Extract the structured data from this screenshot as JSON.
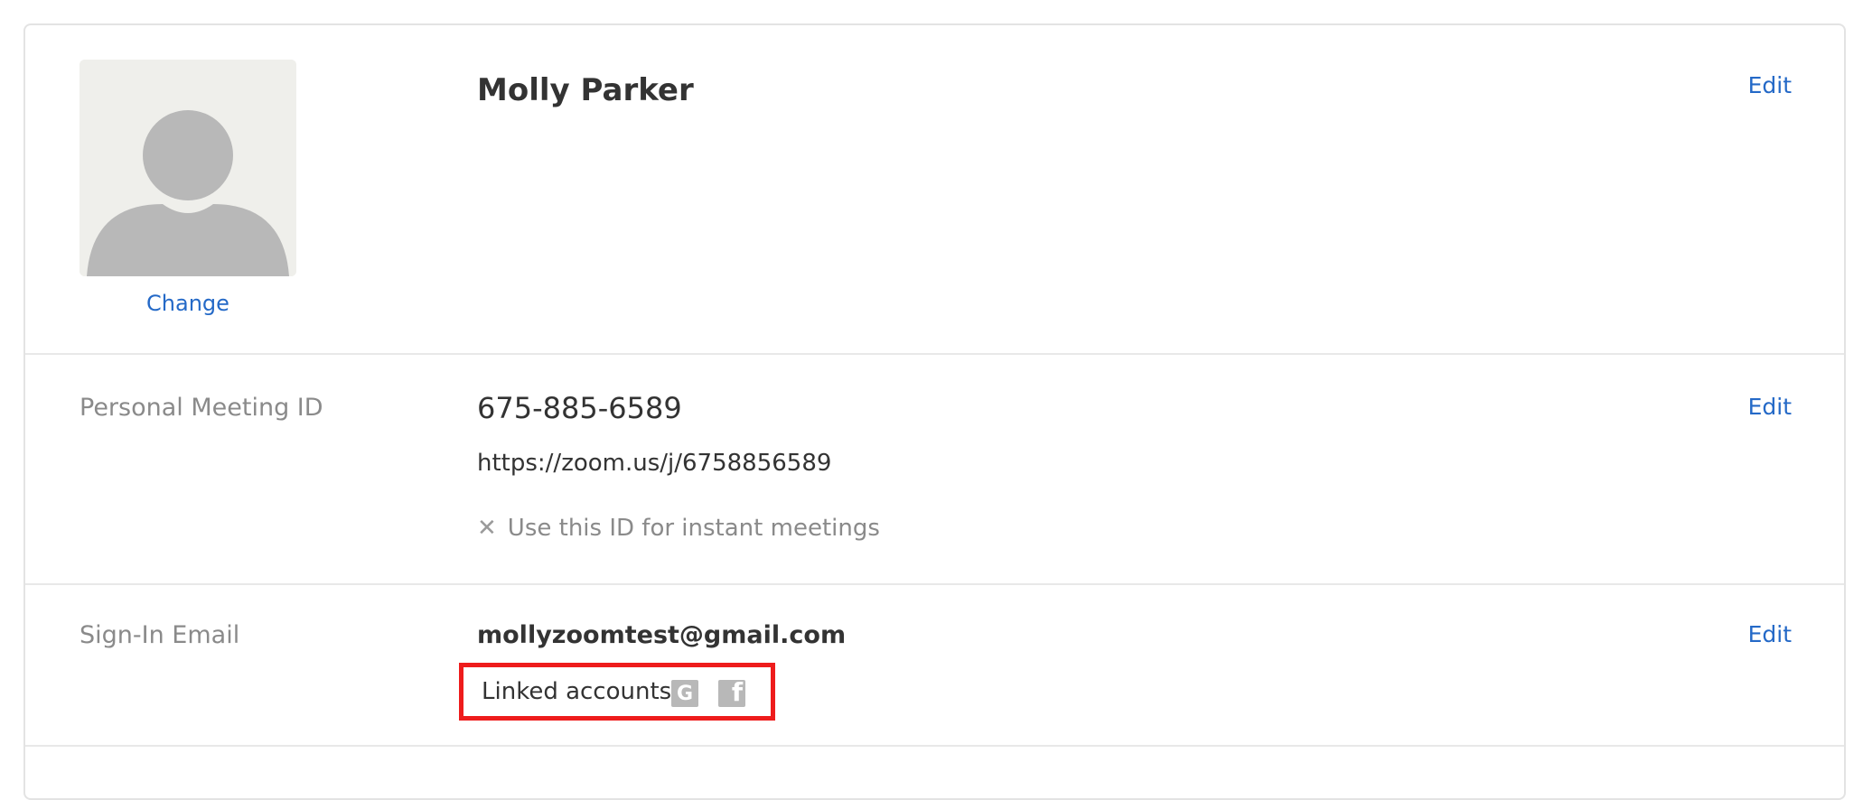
{
  "profile": {
    "name": "Molly Parker",
    "change_label": "Change",
    "edit_label": "Edit"
  },
  "meeting_id": {
    "label": "Personal Meeting ID",
    "value": "675-885-6589",
    "url": "https://zoom.us/j/6758856589",
    "instant_text": "Use this ID for instant meetings",
    "instant_enabled": false,
    "edit_label": "Edit"
  },
  "signin_email": {
    "label": "Sign-In Email",
    "email": "mollyzoomtest@gmail.com",
    "linked_label": "Linked accounts:",
    "linked_accounts": [
      "google-icon",
      "facebook-icon"
    ],
    "edit_label": "Edit"
  },
  "colors": {
    "link": "#2469c7",
    "highlight_border": "#ee1c1c",
    "muted_text": "#8a8a8a",
    "primary_text": "#333333"
  }
}
